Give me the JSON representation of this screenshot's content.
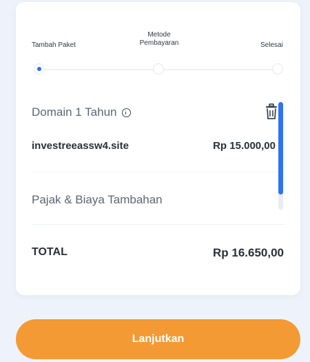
{
  "steps": {
    "items": [
      {
        "label": "Tambah Paket"
      },
      {
        "label": "Metode\nPembayaran"
      },
      {
        "label": "Selesai"
      }
    ],
    "active_index": 0,
    "accent": "#2c6cf0"
  },
  "domain": {
    "title": "Domain 1 Tahun",
    "info_icon": "info-icon",
    "delete_icon": "trash-icon",
    "item_name": "investreeassw4.site",
    "item_price": "Rp 15.000,00"
  },
  "tax": {
    "label": "Pajak & Biaya Tambahan"
  },
  "total": {
    "label": "TOTAL",
    "value": "Rp 16.650,00"
  },
  "action": {
    "continue_label": "Lanjutkan",
    "color": "#f39a34"
  }
}
